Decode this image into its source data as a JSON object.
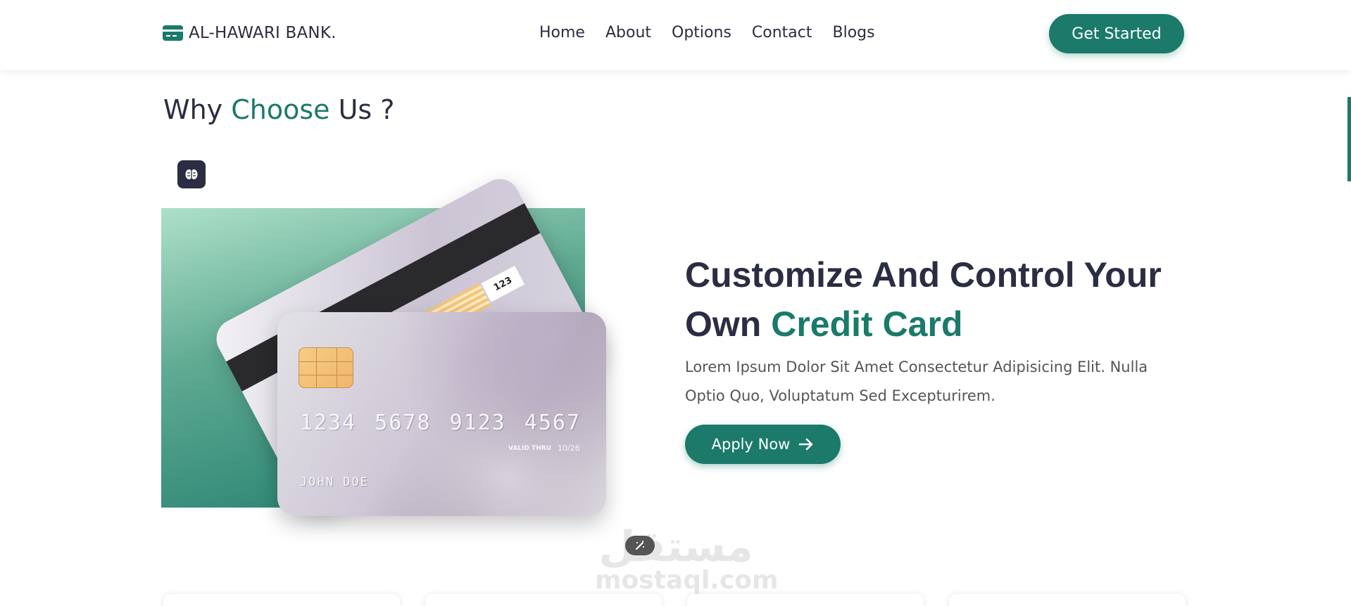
{
  "navbar": {
    "brand": "AL-HAWARI BANK.",
    "links": [
      "Home",
      "About",
      "Options",
      "Contact",
      "Blogs"
    ],
    "cta": "Get Started"
  },
  "section": {
    "title_part1": "Why ",
    "title_accent": "Choose",
    "title_part2": " Us ?"
  },
  "card": {
    "number": "1234 5678 9123 4567",
    "valid_label": "VALID THRU",
    "valid_date": "10/26",
    "holder": "JOHN DOE",
    "cvv": "123"
  },
  "feature": {
    "headline_part1": "Customize And Control Your Own ",
    "headline_accent": "Credit Card",
    "description": "Lorem Ipsum Dolor Sit Amet Consectetur Adipisicing Elit. Nulla Optio Quo, Voluptatum Sed Excepturirem.",
    "button": "Apply Now"
  },
  "watermark": {
    "arabic": "مستقل",
    "url": "mostaql.com"
  },
  "colors": {
    "accent": "#1b7a6a",
    "text": "#2b2d42"
  }
}
